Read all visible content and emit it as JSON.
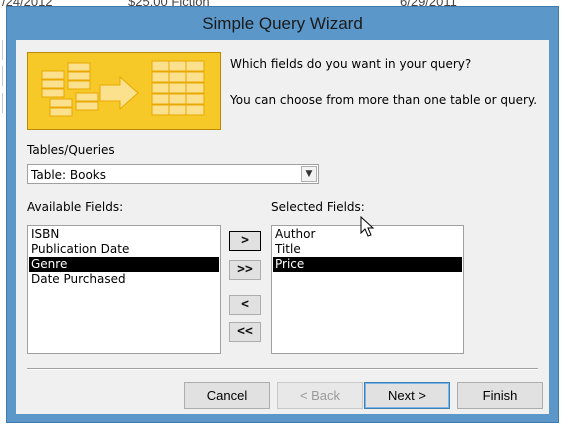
{
  "background": {
    "fragments": [
      "/24/2012",
      "$25.00 Fiction",
      "6/29/2011"
    ]
  },
  "dialog": {
    "title": "Simple Query Wizard",
    "prompt_main": "Which fields do you want in your query?",
    "prompt_sub": "You can choose from more than one table or query.",
    "tables_label": "Tables/Queries",
    "table_selected": "Table: Books",
    "available_label": "Available Fields:",
    "selected_label": "Selected Fields:",
    "available_fields": [
      "ISBN",
      "Publication Date",
      "Genre",
      "Date Purchased"
    ],
    "available_selected": "Genre",
    "selected_fields": [
      "Author",
      "Title",
      "Price"
    ],
    "selected_selected": "Price",
    "move_buttons": {
      "add_one": ">",
      "add_all": ">>",
      "remove_one": "<",
      "remove_all": "<<"
    },
    "buttons": {
      "cancel": "Cancel",
      "back": "< Back",
      "next": "Next >",
      "finish": "Finish"
    }
  },
  "colors": {
    "title_bar": "#5b97c9",
    "banner": "#f4c21c",
    "selection": "#000000"
  },
  "icons": {
    "banner": "query-wizard-graphic",
    "combo": "chevron-down-icon",
    "cursor": "mouse-pointer-icon"
  }
}
